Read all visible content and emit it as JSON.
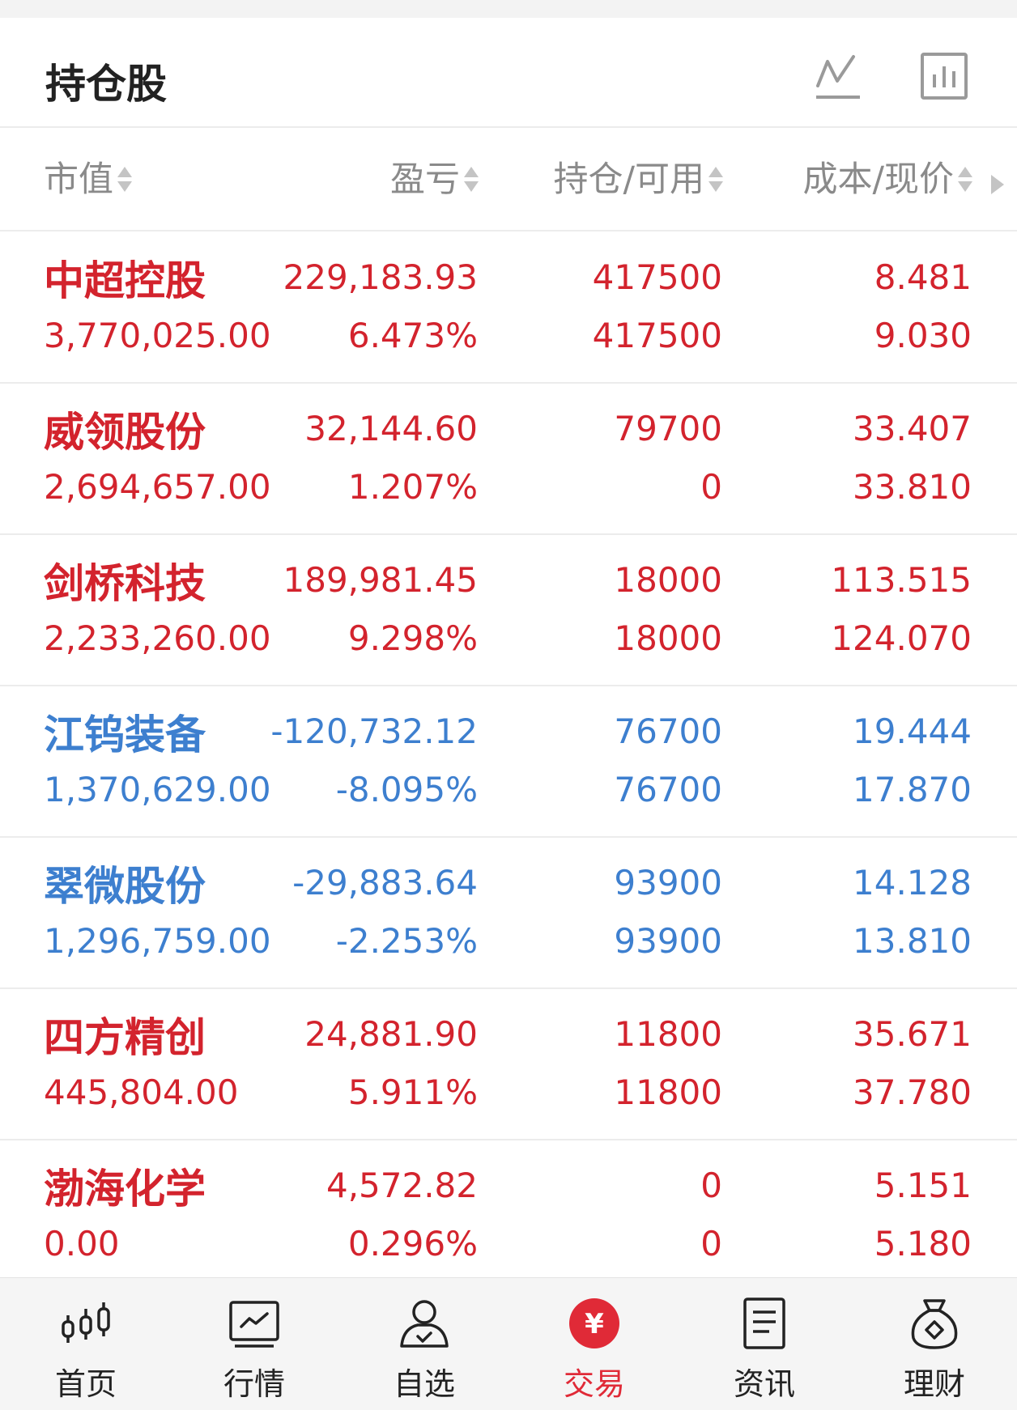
{
  "header": {
    "title": "持仓股",
    "icons": [
      "line-chart-icon",
      "bar-chart-icon"
    ]
  },
  "columns": {
    "market_value": "市值",
    "profit_loss": "盈亏",
    "position_available": "持仓/可用",
    "cost_price": "成本/现价"
  },
  "colors": {
    "up": "#d3232d",
    "down": "#3d7fcf",
    "active_tab": "#e02a37"
  },
  "holdings": [
    {
      "name": "中超控股",
      "market_value": "3,770,025.00",
      "pl": "229,183.93",
      "pl_pct": "6.473%",
      "position": "417500",
      "available": "417500",
      "cost": "8.481",
      "price": "9.030",
      "trend": "up"
    },
    {
      "name": "威领股份",
      "market_value": "2,694,657.00",
      "pl": "32,144.60",
      "pl_pct": "1.207%",
      "position": "79700",
      "available": "0",
      "cost": "33.407",
      "price": "33.810",
      "trend": "up"
    },
    {
      "name": "剑桥科技",
      "market_value": "2,233,260.00",
      "pl": "189,981.45",
      "pl_pct": "9.298%",
      "position": "18000",
      "available": "18000",
      "cost": "113.515",
      "price": "124.070",
      "trend": "up"
    },
    {
      "name": "江钨装备",
      "market_value": "1,370,629.00",
      "pl": "-120,732.12",
      "pl_pct": "-8.095%",
      "position": "76700",
      "available": "76700",
      "cost": "19.444",
      "price": "17.870",
      "trend": "down"
    },
    {
      "name": "翠微股份",
      "market_value": "1,296,759.00",
      "pl": "-29,883.64",
      "pl_pct": "-2.253%",
      "position": "93900",
      "available": "93900",
      "cost": "14.128",
      "price": "13.810",
      "trend": "down"
    },
    {
      "name": "四方精创",
      "market_value": "445,804.00",
      "pl": "24,881.90",
      "pl_pct": "5.911%",
      "position": "11800",
      "available": "11800",
      "cost": "35.671",
      "price": "37.780",
      "trend": "up"
    },
    {
      "name": "渤海化学",
      "market_value": "0.00",
      "pl": "4,572.82",
      "pl_pct": "0.296%",
      "position": "0",
      "available": "0",
      "cost": "5.151",
      "price": "5.180",
      "trend": "up"
    }
  ],
  "tabbar": {
    "items": [
      {
        "label": "首页",
        "icon": "candlestick-icon"
      },
      {
        "label": "行情",
        "icon": "market-chart-icon"
      },
      {
        "label": "自选",
        "icon": "user-check-icon"
      },
      {
        "label": "交易",
        "icon": "yuan-icon",
        "active": true
      },
      {
        "label": "资讯",
        "icon": "news-document-icon"
      },
      {
        "label": "理财",
        "icon": "money-bag-icon"
      }
    ]
  }
}
